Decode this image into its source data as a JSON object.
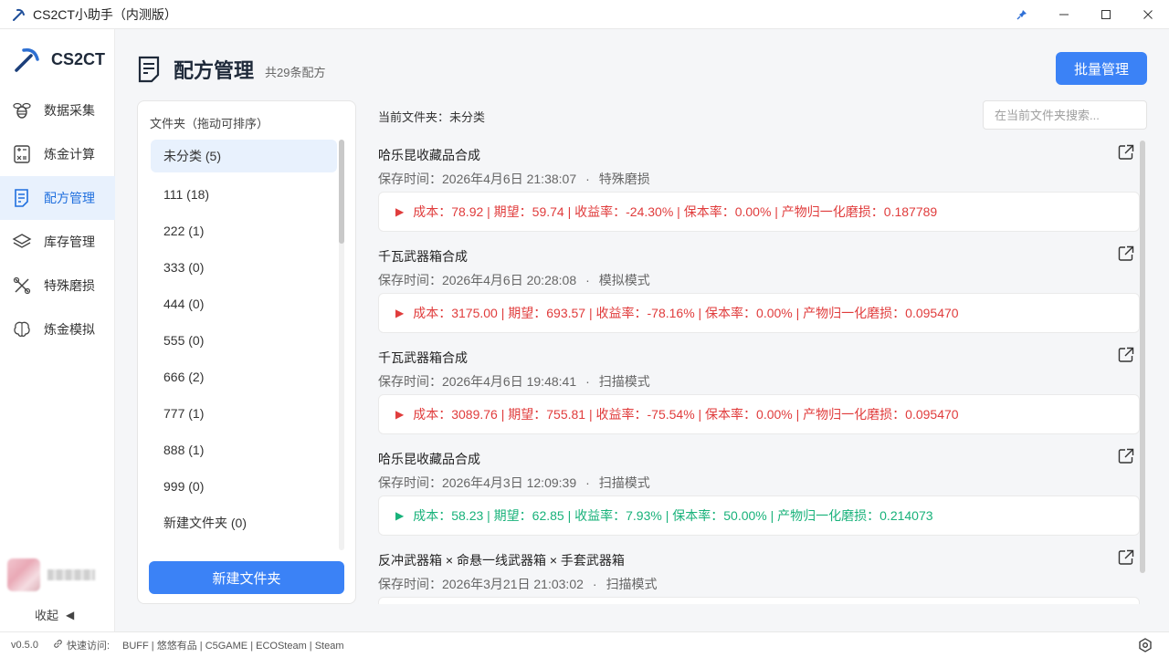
{
  "window": {
    "title": "CS2CT小助手（内测版）",
    "controls": [
      "pin-icon",
      "minimize-icon",
      "maximize-icon",
      "close-icon"
    ]
  },
  "sidebar": {
    "brand": "CS2CT",
    "items": [
      {
        "label": "数据采集",
        "icon": "bee-icon"
      },
      {
        "label": "炼金计算",
        "icon": "calculator-icon"
      },
      {
        "label": "配方管理",
        "icon": "document-icon",
        "active": true
      },
      {
        "label": "库存管理",
        "icon": "layers-icon"
      },
      {
        "label": "特殊磨损",
        "icon": "tools-icon"
      },
      {
        "label": "炼金模拟",
        "icon": "brain-icon"
      }
    ],
    "collapse_label": "收起"
  },
  "page": {
    "title": "配方管理",
    "count": "共29条配方",
    "batch_button": "批量管理"
  },
  "folders": {
    "header": "文件夹（拖动可排序）",
    "items": [
      "未分类 (5)",
      "111 (18)",
      "222 (1)",
      "333 (0)",
      "444 (0)",
      "555 (0)",
      "666 (2)",
      "777 (1)",
      "888 (1)",
      "999 (0)",
      "新建文件夹 (0)"
    ],
    "new_button": "新建文件夹"
  },
  "current_folder": "当前文件夹：未分类",
  "search": {
    "placeholder": "在当前文件夹搜索..."
  },
  "recipes": [
    {
      "name": "哈乐昆收藏品合成",
      "time": "保存时间：2026年4月6日 21:38:07",
      "mode": "特殊磨损",
      "summary": "成本：78.92 | 期望：59.74 | 收益率：-24.30% | 保本率：0.00% | 产物归一化磨损：0.187789",
      "trend": "neg"
    },
    {
      "name": "千瓦武器箱合成",
      "time": "保存时间：2026年4月6日 20:28:08",
      "mode": "模拟模式",
      "summary": "成本：3175.00 | 期望：693.57 | 收益率：-78.16% | 保本率：0.00% | 产物归一化磨损：0.095470",
      "trend": "neg"
    },
    {
      "name": "千瓦武器箱合成",
      "time": "保存时间：2026年4月6日 19:48:41",
      "mode": "扫描模式",
      "summary": "成本：3089.76 | 期望：755.81 | 收益率：-75.54% | 保本率：0.00% | 产物归一化磨损：0.095470",
      "trend": "neg"
    },
    {
      "name": "哈乐昆收藏品合成",
      "time": "保存时间：2026年4月3日 12:09:39",
      "mode": "扫描模式",
      "summary": "成本：58.23 | 期望：62.85 | 收益率：7.93% | 保本率：50.00% | 产物归一化磨损：0.214073",
      "trend": "pos"
    },
    {
      "name": "反冲武器箱 × 命悬一线武器箱 × 手套武器箱",
      "time": "保存时间：2026年3月21日 21:03:02",
      "mode": "扫描模式",
      "summary": "",
      "trend": "neg"
    }
  ],
  "footer": {
    "version": "v0.5.0",
    "quick_label": "快速访问:",
    "links": "BUFF | 悠悠有品 | C5GAME | ECOSteam | Steam"
  },
  "colors": {
    "accent": "#3b82f6",
    "negative": "#e03c3c",
    "positive": "#18b27a",
    "active_bg": "#e8f1fd"
  }
}
